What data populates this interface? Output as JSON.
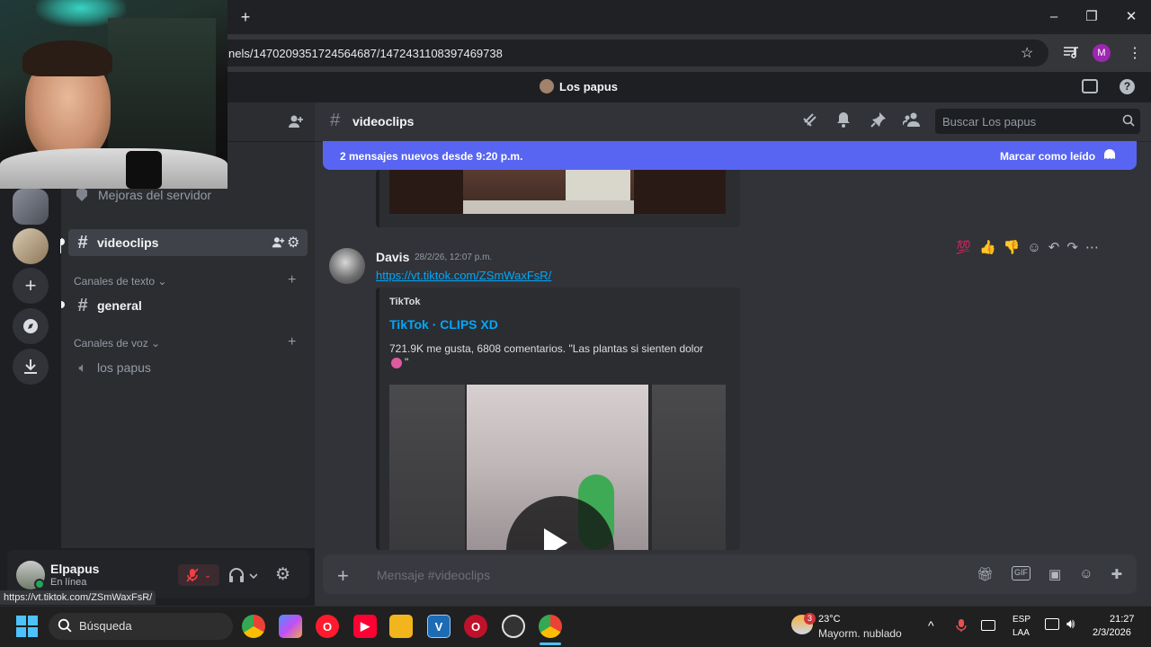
{
  "browser": {
    "url": "nels/1470209351724564687/1472431108397469738",
    "profile_initial": "M",
    "new_tab": "+",
    "minimize": "–",
    "maximize": "❐",
    "close": "✕"
  },
  "discord": {
    "server_title": "Los papus",
    "sidebar": {
      "boost_label": "Mejoras del servidor",
      "active_channel": "videoclips",
      "text_category": "Canales de texto",
      "text_channels": [
        "general"
      ],
      "voice_category": "Canales de voz",
      "voice_channels": [
        "los papus"
      ]
    },
    "user_panel": {
      "username": "Elpapus",
      "status": "En línea"
    },
    "chat": {
      "channel_name": "videoclips",
      "search_placeholder": "Buscar Los papus",
      "new_messages": "2 mensajes nuevos desde 9:20 p.m.",
      "mark_read": "Marcar como leído",
      "message": {
        "author": "Davis",
        "timestamp": "28/2/26, 12:07 p.m.",
        "link": "https://vt.tiktok.com/ZSmWaxFsR/",
        "embed": {
          "provider": "TikTok",
          "title": "TikTok · CLIPS XD",
          "description": "721.9K me gusta, 6808 comentarios. \"Las plantas si sienten dolor",
          "description_end": "\""
        }
      },
      "composer_placeholder": "Mensaje #videoclips"
    },
    "status_bar_url": "https://vt.tiktok.com/ZSmWaxFsR/"
  },
  "taskbar": {
    "search_label": "Búsqueda",
    "weather_temp": "23°C",
    "weather_desc": "Mayorm. nublado",
    "weather_badge": "3",
    "lang_top": "ESP",
    "lang_bottom": "LAA",
    "time": "21:27",
    "date": "2/3/2026"
  },
  "colors": {
    "blurple": "#5865f2",
    "link": "#00a8fc",
    "online": "#23a55a",
    "muted_red": "#f23f43"
  }
}
